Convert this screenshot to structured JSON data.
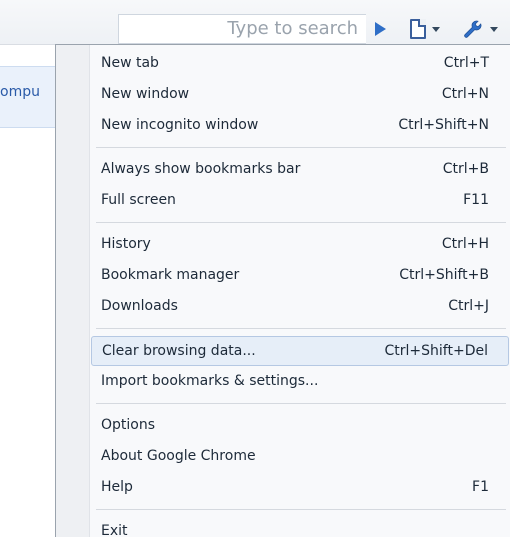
{
  "toolbar": {
    "search_placeholder": "Type to search"
  },
  "left_content": {
    "partial_text": "ompu"
  },
  "menu": {
    "groups": [
      [
        {
          "label": "New tab",
          "shortcut": "Ctrl+T"
        },
        {
          "label": "New window",
          "shortcut": "Ctrl+N"
        },
        {
          "label": "New incognito window",
          "shortcut": "Ctrl+Shift+N"
        }
      ],
      [
        {
          "label": "Always show bookmarks bar",
          "shortcut": "Ctrl+B"
        },
        {
          "label": "Full screen",
          "shortcut": "F11"
        }
      ],
      [
        {
          "label": "History",
          "shortcut": "Ctrl+H"
        },
        {
          "label": "Bookmark manager",
          "shortcut": "Ctrl+Shift+B"
        },
        {
          "label": "Downloads",
          "shortcut": "Ctrl+J"
        }
      ],
      [
        {
          "label": "Clear browsing data...",
          "shortcut": "Ctrl+Shift+Del",
          "highlighted": true
        },
        {
          "label": "Import bookmarks & settings...",
          "shortcut": ""
        }
      ],
      [
        {
          "label": "Options",
          "shortcut": ""
        },
        {
          "label": "About Google Chrome",
          "shortcut": ""
        },
        {
          "label": "Help",
          "shortcut": "F1"
        }
      ],
      [
        {
          "label": "Exit",
          "shortcut": ""
        }
      ]
    ]
  },
  "colors": {
    "accent": "#2f6ec7",
    "highlight_bg": "#e6eef8",
    "highlight_border": "#b5c8e3"
  },
  "icons": {
    "search_go": "play-arrow-icon",
    "page_menu": "page-icon",
    "tools_menu": "wrench-icon"
  }
}
